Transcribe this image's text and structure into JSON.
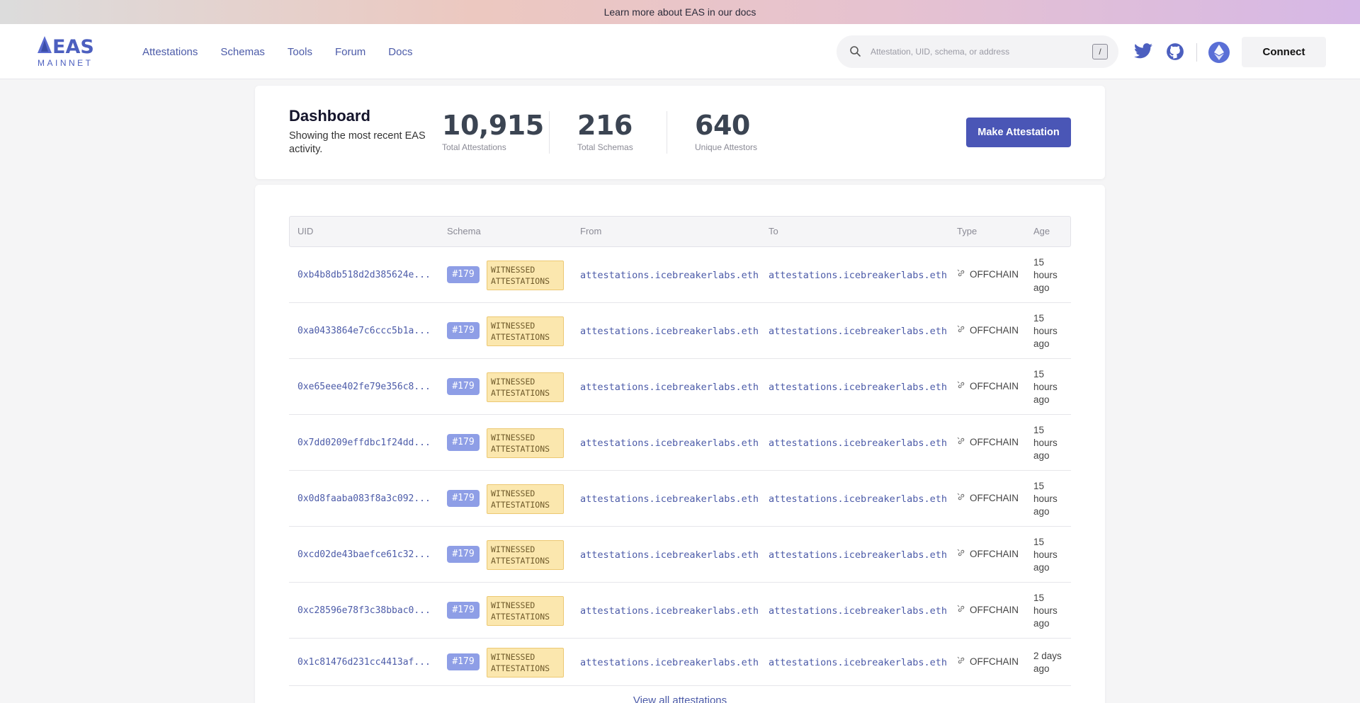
{
  "banner": {
    "text": "Learn more about EAS in our docs"
  },
  "brand": {
    "name": "EAS",
    "network": "MAINNET",
    "color": "#4c5fbf"
  },
  "nav": {
    "items": [
      {
        "label": "Attestations"
      },
      {
        "label": "Schemas"
      },
      {
        "label": "Tools"
      },
      {
        "label": "Forum"
      },
      {
        "label": "Docs"
      }
    ]
  },
  "search": {
    "placeholder": "Attestation, UID, schema, or address",
    "shortcut": "/"
  },
  "header_actions": {
    "connect_label": "Connect",
    "icons": [
      "twitter-icon",
      "github-icon",
      "ethereum-icon"
    ]
  },
  "dashboard": {
    "title": "Dashboard",
    "subtitle": "Showing the most recent EAS activity.",
    "stats": [
      {
        "value": "10,915",
        "label": "Total Attestations"
      },
      {
        "value": "216",
        "label": "Total Schemas"
      },
      {
        "value": "640",
        "label": "Unique Attestors"
      }
    ],
    "make_attestation_label": "Make Attestation",
    "accent_color": "#4a56b6"
  },
  "table": {
    "columns": [
      "UID",
      "Schema",
      "From",
      "To",
      "Type",
      "Age"
    ],
    "rows": [
      {
        "uid": "0xb4b8db518d2d385624e...",
        "schema_num": "#179",
        "schema_name": "WITNESSED ATTESTATIONS",
        "from": "attestations.icebreakerlabs.eth",
        "to": "attestations.icebreakerlabs.eth",
        "type": "OFFCHAIN",
        "age": "15 hours ago"
      },
      {
        "uid": "0xa0433864e7c6ccc5b1a...",
        "schema_num": "#179",
        "schema_name": "WITNESSED ATTESTATIONS",
        "from": "attestations.icebreakerlabs.eth",
        "to": "attestations.icebreakerlabs.eth",
        "type": "OFFCHAIN",
        "age": "15 hours ago"
      },
      {
        "uid": "0xe65eee402fe79e356c8...",
        "schema_num": "#179",
        "schema_name": "WITNESSED ATTESTATIONS",
        "from": "attestations.icebreakerlabs.eth",
        "to": "attestations.icebreakerlabs.eth",
        "type": "OFFCHAIN",
        "age": "15 hours ago"
      },
      {
        "uid": "0x7dd0209effdbc1f24dd...",
        "schema_num": "#179",
        "schema_name": "WITNESSED ATTESTATIONS",
        "from": "attestations.icebreakerlabs.eth",
        "to": "attestations.icebreakerlabs.eth",
        "type": "OFFCHAIN",
        "age": "15 hours ago"
      },
      {
        "uid": "0x0d8faaba083f8a3c092...",
        "schema_num": "#179",
        "schema_name": "WITNESSED ATTESTATIONS",
        "from": "attestations.icebreakerlabs.eth",
        "to": "attestations.icebreakerlabs.eth",
        "type": "OFFCHAIN",
        "age": "15 hours ago"
      },
      {
        "uid": "0xcd02de43baefce61c32...",
        "schema_num": "#179",
        "schema_name": "WITNESSED ATTESTATIONS",
        "from": "attestations.icebreakerlabs.eth",
        "to": "attestations.icebreakerlabs.eth",
        "type": "OFFCHAIN",
        "age": "15 hours ago"
      },
      {
        "uid": "0xc28596e78f3c38bbac0...",
        "schema_num": "#179",
        "schema_name": "WITNESSED ATTESTATIONS",
        "from": "attestations.icebreakerlabs.eth",
        "to": "attestations.icebreakerlabs.eth",
        "type": "OFFCHAIN",
        "age": "15 hours ago"
      },
      {
        "uid": "0x1c81476d231cc4413af...",
        "schema_num": "#179",
        "schema_name": "WITNESSED ATTESTATIONS",
        "from": "attestations.icebreakerlabs.eth",
        "to": "attestations.icebreakerlabs.eth",
        "type": "OFFCHAIN",
        "age": "2 days ago"
      }
    ],
    "view_all_label": "View all attestations"
  }
}
